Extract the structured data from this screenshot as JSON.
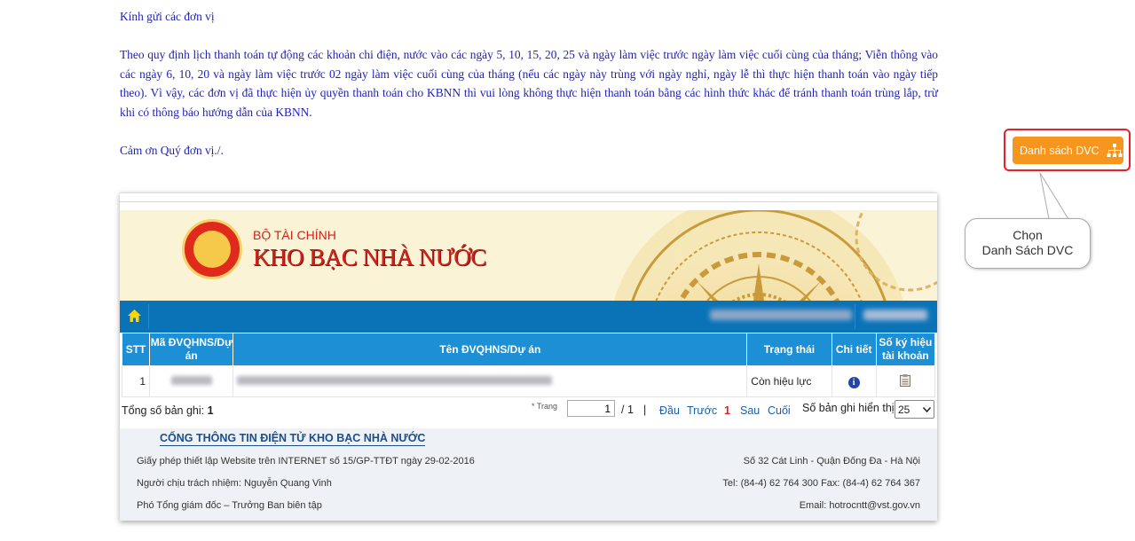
{
  "notice": {
    "greeting": "Kính gửi các đơn vị",
    "body": "Theo quy định lịch thanh toán tự động các khoản chi điện, nước vào các ngày 5, 10, 15, 20, 25 và ngày làm việc trước ngày làm việc cuối cùng của tháng; Viễn thông vào các ngày 6, 10, 20 và ngày làm việc trước 02 ngày làm việc cuối cùng của tháng (nếu các ngày này trùng với ngày nghỉ, ngày lễ thì thực hiện thanh toán vào ngày tiếp theo). Vì vậy, các đơn vị đã thực hiện ủy quyền thanh toán cho KBNN thì vui lòng không thực hiện thanh toán bằng các hình thức khác để tránh thanh toán trùng lắp, trừ khi có thông báo hướng dẫn của KBNN.",
    "closing": "Cảm ơn Quý đơn vị./."
  },
  "dvc_button": {
    "label": "Danh sách DVC",
    "icon": "sitemap-icon",
    "color": "#f7961e",
    "highlight": "#e8202a"
  },
  "callout": {
    "line1": "Chọn",
    "line2": "Danh Sách DVC"
  },
  "banner": {
    "ministry": "BỘ TÀI CHÍNH",
    "agency": "KHO BẠC NHÀ NƯỚC"
  },
  "table": {
    "headers": {
      "stt": "STT",
      "ma": "Mã ĐVQHNS/Dự án",
      "ten": "Tên ĐVQHNS/Dự án",
      "trang_thai": "Trạng thái",
      "chi_tiet": "Chi tiết",
      "so_ky_hieu": "Số ký hiệu tài khoản"
    },
    "rows": [
      {
        "stt": "1",
        "trang_thai": "Còn hiệu lực"
      }
    ]
  },
  "pager": {
    "total_label": "Tổng số bản ghi:",
    "total_value": "1",
    "page_label": "* Trang",
    "page_value": "1",
    "page_of": "/ 1",
    "sep": "|",
    "first": "Đầu",
    "prev": "Trước",
    "current": "1",
    "next": "Sau",
    "last": "Cuối",
    "per_page_label": "Số bản ghi hiển thị",
    "per_page_value": "25"
  },
  "footer": {
    "title": "CỔNG THÔNG TIN ĐIỆN TỬ KHO BẠC NHÀ NƯỚC",
    "license": "Giấy phép thiết lập Website trên INTERNET số 15/GP-TTĐT ngày 29-02-2016",
    "responsible": "Người chịu trách nhiệm: Nguyễn Quang Vinh",
    "editor": "Phó Tổng giám đốc – Trưởng Ban biên tập",
    "address": "Số 32 Cát Linh - Quận Đống Đa - Hà Nội",
    "phone": "Tel: (84-4) 62 764 300 Fax: (84-4) 62 764 367",
    "email": "Email: hotrocntt@vst.gov.vn"
  }
}
